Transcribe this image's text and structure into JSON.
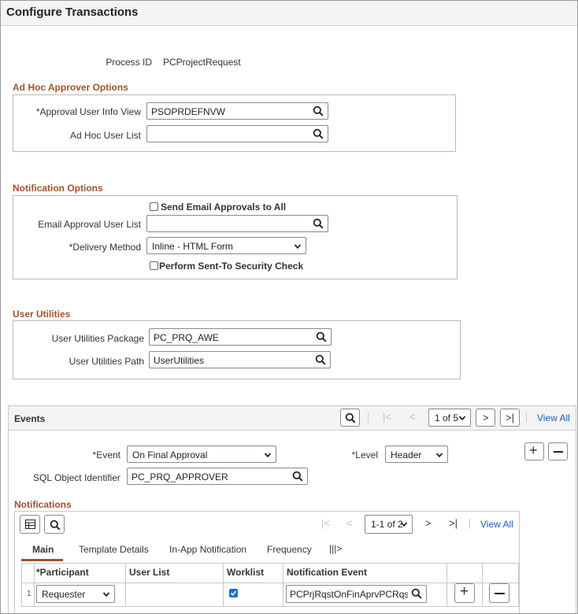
{
  "page_title": "Configure Transactions",
  "process": {
    "label": "Process ID",
    "value": "PCProjectRequest"
  },
  "adhoc": {
    "title": "Ad Hoc Approver Options",
    "approval_view_label": "*Approval User Info View",
    "approval_view_value": "PSOPRDEFNVW",
    "adhoc_list_label": "Ad Hoc User List",
    "adhoc_list_value": ""
  },
  "notification": {
    "title": "Notification Options",
    "send_all_label": "Send Email Approvals to All",
    "email_list_label": "Email Approval User List",
    "email_list_value": "",
    "delivery_label": "*Delivery Method",
    "delivery_value": "Inline - HTML Form",
    "security_check_label": "Perform Sent-To Security Check"
  },
  "utilities": {
    "title": "User Utilities",
    "package_label": "User Utilities Package",
    "package_value": "PC_PRQ_AWE",
    "path_label": "User Utilities Path",
    "path_value": "UserUtilities"
  },
  "events": {
    "title": "Events",
    "pager": "1 of 5",
    "view_all": "View All",
    "event_label": "*Event",
    "event_value": "On Final Approval",
    "level_label": "*Level",
    "level_value": "Header",
    "sql_label": "SQL Object Identifier",
    "sql_value": "PC_PRQ_APPROVER"
  },
  "notifications": {
    "title": "Notifications",
    "pager": "1-1 of 2",
    "view_all": "View All",
    "tabs": [
      "Main",
      "Template Details",
      "In-App Notification",
      "Frequency"
    ],
    "columns": [
      "*Participant",
      "User List",
      "Worklist",
      "Notification Event"
    ],
    "row": {
      "num": "1",
      "participant": "Requester",
      "user_list": "",
      "worklist_checked": true,
      "event": "PCPrjRqstOnFinAprvPCRqstrH"
    }
  },
  "icons": {
    "search": "search-icon",
    "chevron": "chevron-down-icon",
    "add": "plus-icon",
    "remove": "minus-icon",
    "accent_color": "#a0522d",
    "link_color": "#1a5fb4"
  }
}
